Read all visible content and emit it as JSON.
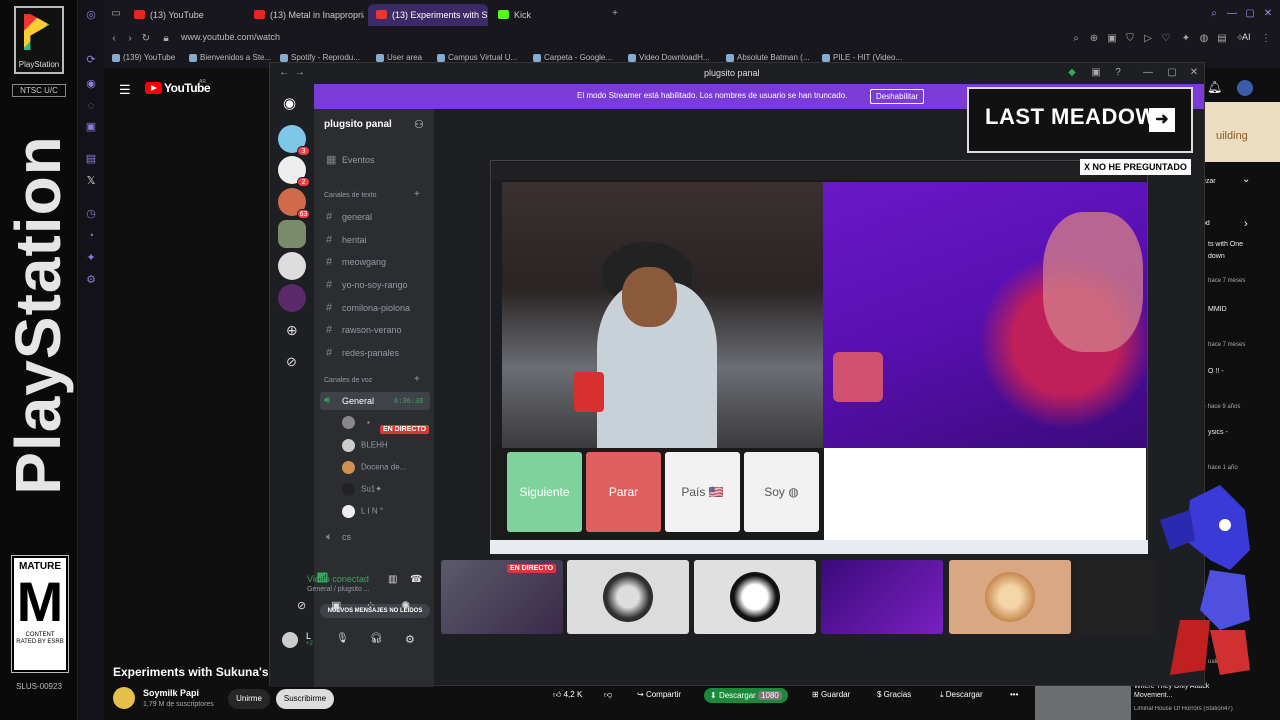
{
  "playstation": {
    "logo_text": "PlayStation",
    "ntsc": "NTSC U/C",
    "wordmark": "PlayStation",
    "rating_top": "MATURE",
    "rating_letter": "M",
    "rating_bottom": "CONTENT RATED BY ESRB",
    "serial": "SLUS-00923"
  },
  "browser": {
    "tabs": [
      {
        "label": "(13) YouTube"
      },
      {
        "label": "(13) Metal in Inappropriate"
      },
      {
        "label": "(13) Experiments with Su"
      },
      {
        "label": "Kick"
      }
    ],
    "url": "www.youtube.com/watch",
    "bookmarks": [
      "(139) YouTube",
      "Bienvenidos a Ste...",
      "Spotify - Reprodu...",
      "User area",
      "Campus Virtual U...",
      "Carpeta - Google...",
      "Video DownloadH...",
      "Absolute Batman (...",
      "PILE - HIT (Video..."
    ],
    "ai_label": "AI"
  },
  "youtube": {
    "logo": "YouTube",
    "country": "AR",
    "video_title": "Experiments with Sukuna's Pow",
    "channel": "Soymilk Papi",
    "subscribers": "1,79 M de suscriptores",
    "join": "Unirme",
    "subscribe": "Suscribirme",
    "likes": "4,2 K",
    "share": "Compartir",
    "download_left": "Descargar",
    "quality": "1080",
    "save": "Guardar",
    "thanks": "Gracias",
    "download": "Descargar",
    "side": [
      {
        "title": "uilding",
        "sub": ""
      },
      {
        "title": "ezar",
        "sub": ""
      },
      {
        "title": "od",
        "sub": ""
      },
      {
        "title": "ts with One",
        "sub": "down"
      },
      {
        "title": "",
        "sub": "hace 7 meses"
      },
      {
        "title": "MMID",
        "sub": ""
      },
      {
        "title": "",
        "sub": "hace 7 meses"
      },
      {
        "title": "O !! -",
        "sub": ""
      },
      {
        "title": "",
        "sub": "- hace 9 años"
      },
      {
        "title": "ysics -",
        "sub": ""
      },
      {
        "title": "",
        "sub": "hace 1 año"
      },
      {
        "title": "",
        "sub": "ualizaciones"
      },
      {
        "title": "Where They Only Attack Movement...",
        "sub": "Liminal House Of Horrors (Station47)"
      }
    ]
  },
  "discord": {
    "window_title": "plugsito panal",
    "streamer_banner": "El modo Streamer está habilitado. Los nombres de usuario se han truncado.",
    "disable_button": "Deshabilitar",
    "servers": [
      {
        "badge": "3",
        "color": "#7fc7e8"
      },
      {
        "badge": "2",
        "color": "#eeeeee"
      },
      {
        "badge": "63",
        "color": "#d06a4a"
      },
      {
        "badge": "",
        "color": "#7a8a6a"
      },
      {
        "badge": "",
        "color": "#dddddd"
      },
      {
        "badge": "",
        "color": "#5a2a6a"
      }
    ],
    "server_name": "plugsito panal",
    "events": "Eventos",
    "text_category": "Canales de texto",
    "text_channels": [
      "general",
      "hentai",
      "meowgang",
      "yo-no-soy-rango",
      "comilona-piolona",
      "rawson-verano",
      "redes-panales"
    ],
    "voice_category": "Canales de voz",
    "voice_channel": "General",
    "voice_timer": "6:36:30",
    "voice_users": [
      "",
      "BLEHH",
      "Docena de...",
      "Su1✦",
      "L I N °"
    ],
    "live_badge": "EN DIRECTO",
    "other_voice": "cs",
    "new_messages": "NUEVOS MENSAJES NO LEÍDOS",
    "video_connected": "Video conectad",
    "video_sub": "General / plugsito ...",
    "user_short": "L",
    "user_tag": "+2",
    "thumb_live": "EN DIRECTO"
  },
  "stream": {
    "btn_next": "Siguiente",
    "btn_stop": "Parar",
    "btn_country": "País",
    "btn_soy": "Soy",
    "colors": {
      "next": "#7fd39a",
      "stop": "#e06060",
      "neutral": "#f2f2f2"
    }
  },
  "overlay": {
    "last_meadow": "LAST MEADOW",
    "arrow": "➜",
    "nohe": "X NO HE PREGUNTADO"
  }
}
